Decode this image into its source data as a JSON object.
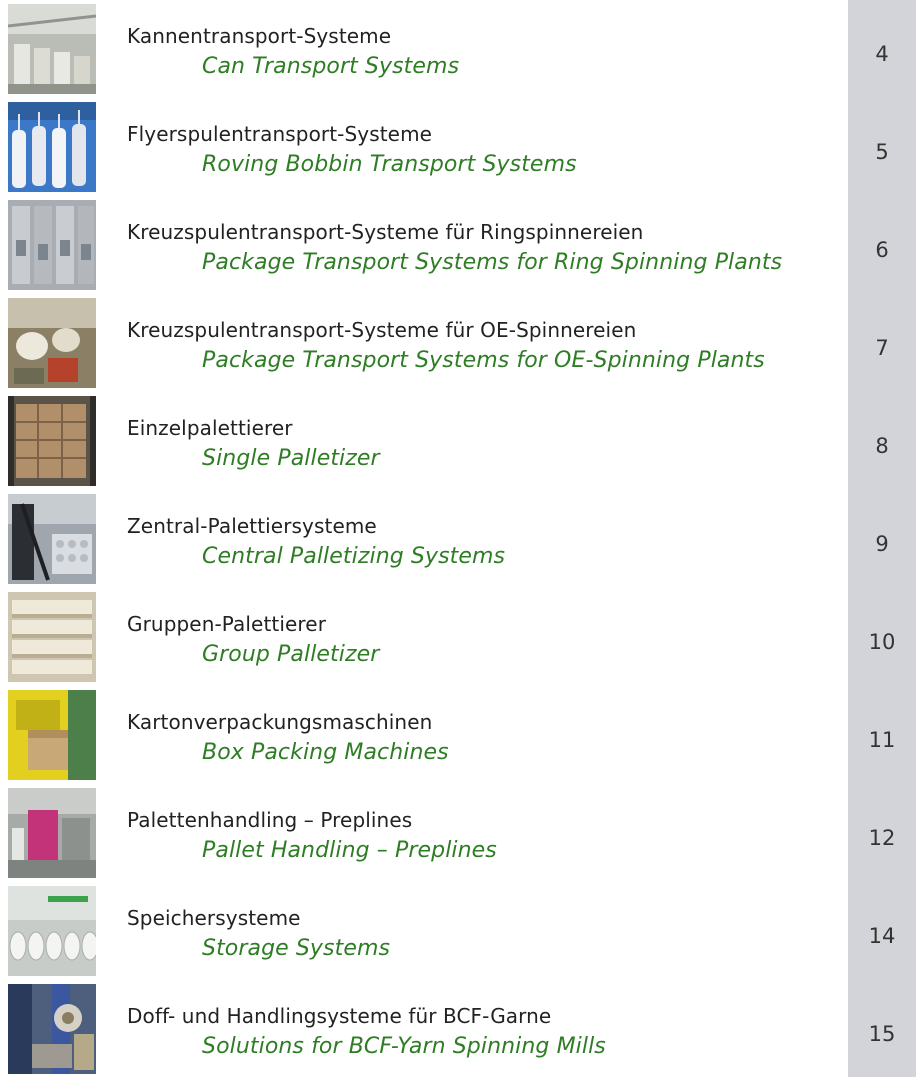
{
  "toc": [
    {
      "de": "Kannentransport-Systeme",
      "en": "Can Transport Systems",
      "page": "4",
      "image": "can-transport-photo"
    },
    {
      "de": "Flyerspulentransport-Systeme",
      "en": "Roving Bobbin Transport Systems",
      "page": "5",
      "image": "roving-bobbin-photo"
    },
    {
      "de": "Kreuzspulentransport-Systeme für Ringspinnereien",
      "en": "Package Transport Systems for Ring Spinning Plants",
      "page": "6",
      "image": "ring-spinning-photo"
    },
    {
      "de": "Kreuzspulentransport-Systeme für OE-Spinnereien",
      "en": "Package Transport Systems for OE-Spinning Plants",
      "page": "7",
      "image": "oe-spinning-photo"
    },
    {
      "de": "Einzelpalettierer",
      "en": "Single Palletizer",
      "page": "8",
      "image": "single-palletizer-photo"
    },
    {
      "de": "Zentral-Palettiersysteme",
      "en": "Central Palletizing Systems",
      "page": "9",
      "image": "central-palletizing-photo"
    },
    {
      "de": "Gruppen-Palettierer",
      "en": "Group Palletizer",
      "page": "10",
      "image": "group-palletizer-photo"
    },
    {
      "de": "Kartonverpackungsmaschinen",
      "en": "Box Packing Machines",
      "page": "11",
      "image": "box-packing-photo"
    },
    {
      "de": "Palettenhandling – Preplines",
      "en": "Pallet Handling – Preplines",
      "page": "12",
      "image": "pallet-handling-photo"
    },
    {
      "de": "Speichersysteme",
      "en": "Storage Systems",
      "page": "14",
      "image": "storage-systems-photo"
    },
    {
      "de": "Doff- und Handlingsysteme für BCF-Garne",
      "en": "Solutions for BCF-Yarn Spinning Mills",
      "page": "15",
      "image": "bcf-yarn-photo"
    }
  ],
  "colors": {
    "english_title": "#2e7d24",
    "german_title": "#222222",
    "sidebar": "#d3d4d9"
  }
}
